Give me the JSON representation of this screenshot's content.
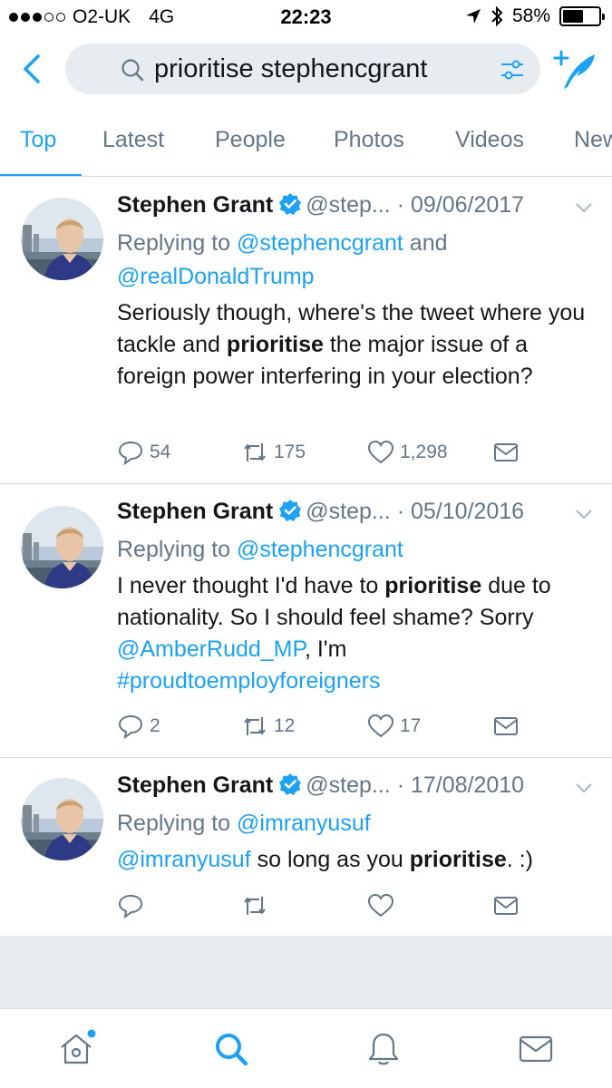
{
  "status_bar": {
    "carrier": "O2-UK",
    "network": "4G",
    "time": "22:23",
    "battery": "58%",
    "battery_level": 0.58
  },
  "search": {
    "query": "prioritise stephencgrant"
  },
  "tabs": [
    {
      "label": "Top",
      "active": true
    },
    {
      "label": "Latest"
    },
    {
      "label": "People"
    },
    {
      "label": "Photos"
    },
    {
      "label": "Videos"
    },
    {
      "label": "New"
    }
  ],
  "tweets": [
    {
      "name": "Stephen Grant",
      "handle": "@step...",
      "date": "· 09/06/2017",
      "replying_prefix": "Replying to ",
      "replying_to": [
        "@stephencgrant",
        "@realDonaldTrump"
      ],
      "replying_join": " and ",
      "text_before": "Seriously though, where's the tweet where you tackle and ",
      "highlight": "prioritise",
      "text_after": " the major issue of a foreign power interfering in your election?",
      "replies": "54",
      "retweets": "175",
      "likes": "1,298"
    },
    {
      "name": "Stephen Grant",
      "handle": "@step...",
      "date": "· 05/10/2016",
      "replying_prefix": "Replying to ",
      "replying_to": [
        "@stephencgrant"
      ],
      "text_before": "I never thought I'd have to ",
      "highlight": "prioritise",
      "text_after": " due to nationality. So I should feel shame? Sorry ",
      "mention": "@AmberRudd_MP",
      "text_after2": ", I'm ",
      "hashtag": "#proudtoemployforeigners",
      "replies": "2",
      "retweets": "12",
      "likes": "17"
    },
    {
      "name": "Stephen Grant",
      "handle": "@step...",
      "date": "· 17/08/2010",
      "replying_prefix": "Replying to ",
      "replying_to": [
        "@imranyusuf"
      ],
      "mention_lead": "@imranyusuf",
      "text_before": " so long as you ",
      "highlight": "prioritise",
      "text_after": ". :)",
      "replies": "",
      "retweets": "",
      "likes": ""
    }
  ],
  "icons": {
    "back": "chevron-left-icon",
    "search": "search-icon",
    "filter": "filter-icon",
    "compose": "compose-tweet-icon",
    "verified": "verified-badge-icon",
    "reply": "reply-icon",
    "retweet": "retweet-icon",
    "like": "heart-icon",
    "dm": "envelope-icon",
    "nav_home": "home-icon",
    "nav_search": "search-icon",
    "nav_notifications": "bell-icon",
    "nav_messages": "envelope-icon"
  },
  "colors": {
    "accent": "#1da1f2",
    "secondary_text": "#657786",
    "primary_text": "#14171a",
    "search_bg": "#e6ecf0"
  }
}
